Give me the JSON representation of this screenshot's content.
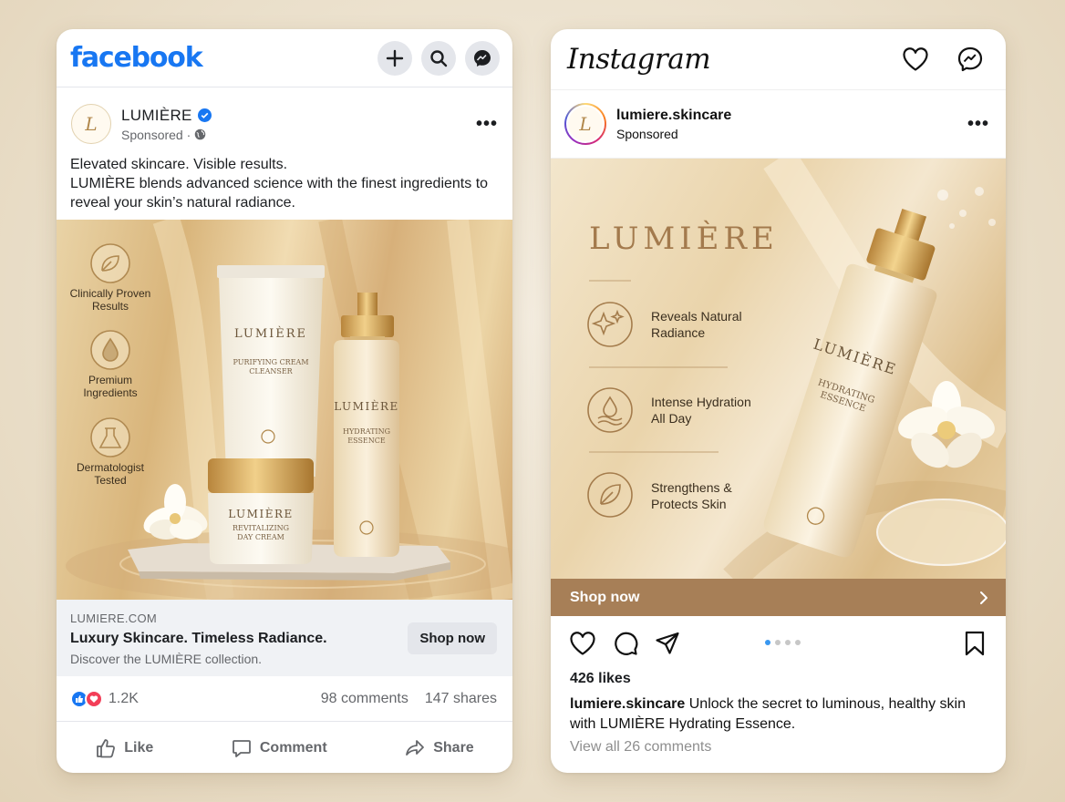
{
  "facebook": {
    "logo": "facebook",
    "page_name": "LUMIÈRE",
    "sponsored": "Sponsored ·",
    "post_text": "Elevated skincare. Visible results.\nLUMIÈRE blends advanced science with the finest ingredients to reveal your skin’s natural radiance.",
    "features": [
      {
        "icon": "leaf-icon",
        "label": "Clinically Proven Results"
      },
      {
        "icon": "drop-icon",
        "label": "Premium Ingredients"
      },
      {
        "icon": "flask-icon",
        "label": "Dermatologist Tested"
      }
    ],
    "products": {
      "tube_brand": "LUMIÈRE",
      "tube_name": "PURIFYING CREAM CLEANSER",
      "bottle_brand": "LUMIÈRE",
      "bottle_name": "HYDRATING ESSENCE",
      "jar_brand": "LUMIÈRE",
      "jar_name": "REVITALIZING DAY CREAM"
    },
    "link": {
      "domain": "LUMIERE.COM",
      "headline": "Luxury Skincare. Timeless Radiance.",
      "description": "Discover the LUMIÈRE collection.",
      "cta": "Shop now"
    },
    "reactions_count": "1.2K",
    "comments": "98 comments",
    "shares": "147 shares",
    "actions": {
      "like": "Like",
      "comment": "Comment",
      "share": "Share"
    },
    "colors": {
      "brand": "#1877f2",
      "like": "#1877f2",
      "love": "#f33e58"
    }
  },
  "instagram": {
    "logo": "Instagram",
    "username": "lumiere.skincare",
    "sponsored": "Sponsored",
    "image": {
      "brand": "LUMIÈRE",
      "benefits": [
        {
          "icon": "sparkle-icon",
          "label": "Reveals Natural Radiance"
        },
        {
          "icon": "water-drop-icon",
          "label": "Intense Hydration All Day"
        },
        {
          "icon": "leaf-icon",
          "label": "Strengthens & Protects Skin"
        }
      ],
      "bottle_brand": "LUMIÈRE",
      "bottle_name": "HYDRATING ESSENCE"
    },
    "cta": "Shop now",
    "likes": "426 likes",
    "caption_user": "lumiere.skincare",
    "caption_text": "Unlock the secret to luminous, healthy skin with LUMIÈRE Hydrating Essence.",
    "view_comments": "View all 26 comments",
    "carousel": {
      "count": 4,
      "active": 1
    },
    "colors": {
      "cta_bar": "#a77f57",
      "dot_active": "#3897f0"
    }
  }
}
